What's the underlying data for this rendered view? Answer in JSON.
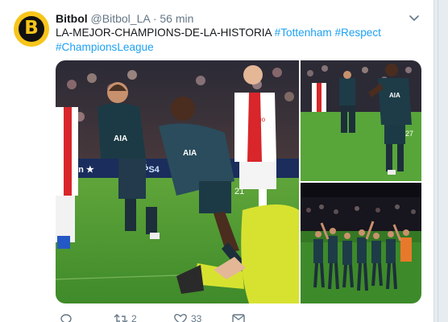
{
  "tweet": {
    "display_name": "Bitbol",
    "handle": "@Bitbol_LA",
    "separator": "·",
    "time": "56 min",
    "text_main": "LA-MEJOR-CHAMPIONS-DE-LA-HISTORIA",
    "hashtags": [
      "#Tottenham",
      "#Respect",
      "#ChampionsLeague"
    ],
    "avatar_letter": "B"
  },
  "media": {
    "main_photo": {
      "ad_board_left": "en ★",
      "ad_board_right": "PS4",
      "jersey_sponsor": "AIA",
      "player_number": "15",
      "player_number_2": "21",
      "opponent_sponsor": "Ziggo"
    },
    "top_right_photo": {
      "player_number": "27",
      "sponsor": "AIA"
    },
    "bottom_right_photo": {}
  },
  "actions": {
    "reply_count": "",
    "retweet_count": "2",
    "like_count": "33",
    "dm_count": ""
  },
  "colors": {
    "link": "#1da1f2",
    "avatar_bg": "#f7c51b",
    "muted_text": "#657786"
  },
  "icons": [
    "chevron-down-icon",
    "reply-icon",
    "retweet-icon",
    "like-icon",
    "message-icon"
  ]
}
